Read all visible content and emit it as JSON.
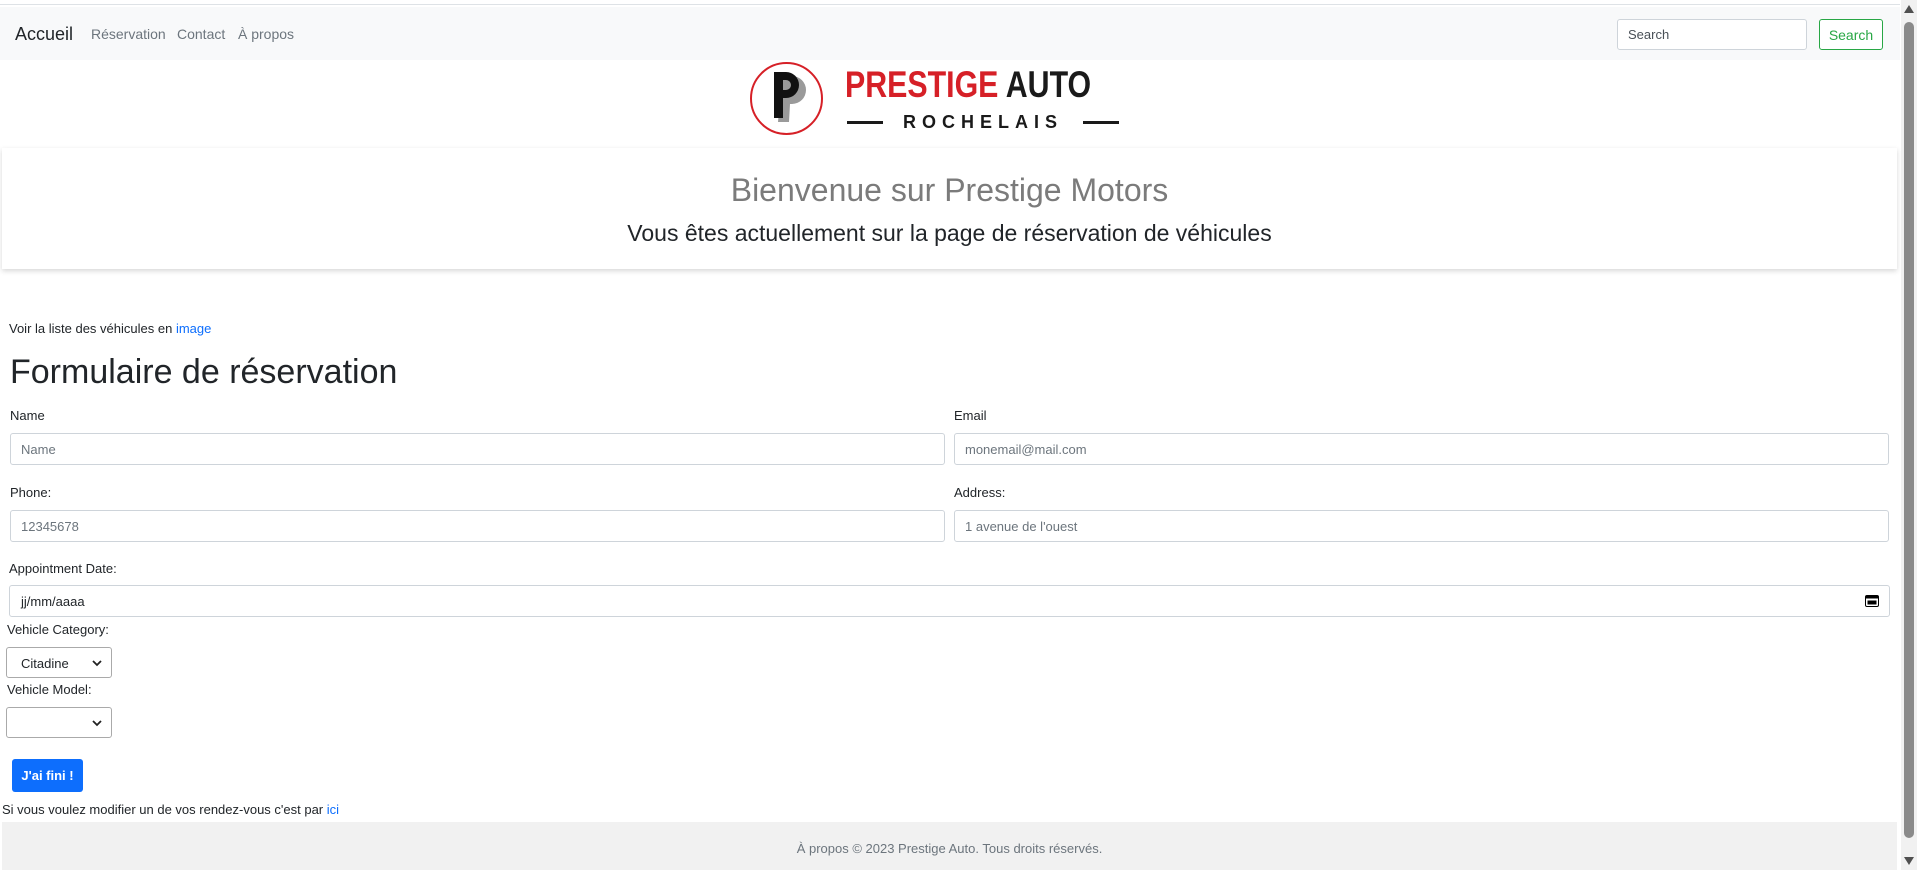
{
  "navbar": {
    "brand": "Accueil",
    "links": [
      "Réservation",
      "Contact",
      "À propos"
    ],
    "search_placeholder": "Search",
    "search_button": "Search"
  },
  "logo": {
    "line1_red": "PRESTIGE",
    "line1_black": "AUTO",
    "line2": "ROCHELAIS",
    "colors": {
      "red": "#d62027",
      "black": "#1a1a1a"
    }
  },
  "hero": {
    "title": "Bienvenue sur Prestige Motors",
    "subtitle": "Vous êtes actuellement sur la page de réservation de véhicules"
  },
  "vehicles_link": {
    "prefix": "Voir la liste des véhicules en",
    "link_text": "image"
  },
  "form": {
    "title": "Formulaire de réservation",
    "name_label": "Name",
    "name_placeholder": "Name",
    "email_label": "Email",
    "email_placeholder": "monemail@mail.com",
    "phone_label": "Phone:",
    "phone_placeholder": "12345678",
    "address_label": "Address:",
    "address_placeholder": "1 avenue de l'ouest",
    "date_label": "Appointment Date:",
    "date_placeholder": "jj/mm/aaaa",
    "category_label": "Vehicle Category:",
    "category_selected": "Citadine",
    "model_label": "Vehicle Model:",
    "model_selected": "",
    "submit": "J'ai fini !"
  },
  "modify_line": {
    "prefix": "Si vous voulez modifier un de vos rendez-vous c'est par",
    "link_text": "ici"
  },
  "footer": {
    "text": "À propos © 2023 Prestige Auto. Tous droits réservés."
  },
  "colors": {
    "primary": "#0d6efd",
    "success": "#28a745",
    "navbar_bg": "#f8f9fa",
    "footer_bg": "#f1f1f1"
  }
}
